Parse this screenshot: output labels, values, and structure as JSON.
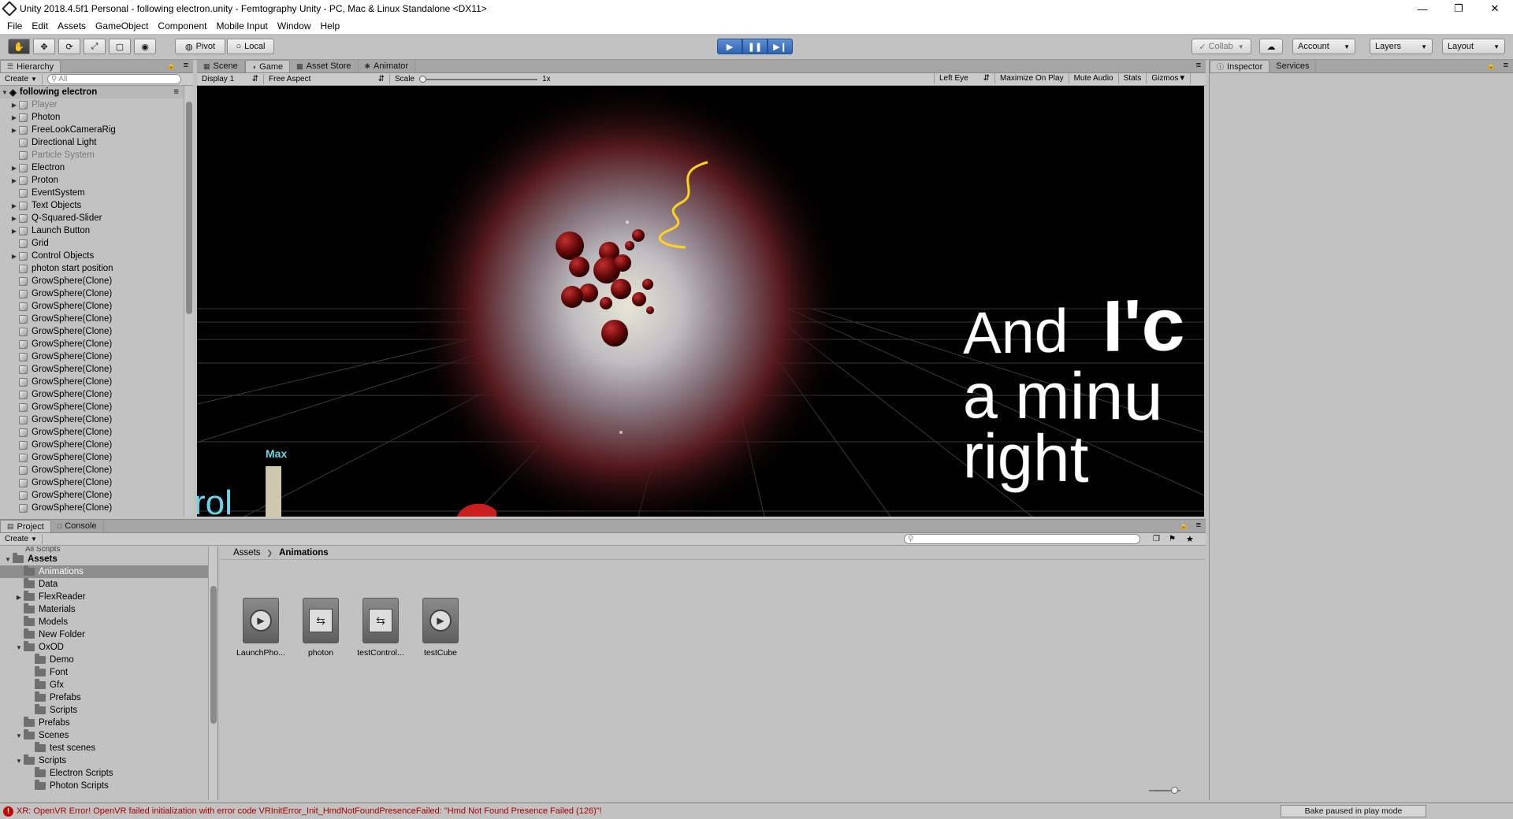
{
  "window": {
    "title": "Unity 2018.4.5f1 Personal - following electron.unity - Femtography Unity - PC, Mac & Linux Standalone <DX11>"
  },
  "menu": [
    "File",
    "Edit",
    "Assets",
    "GameObject",
    "Component",
    "Mobile Input",
    "Window",
    "Help"
  ],
  "toolbar": {
    "pivot": "Pivot",
    "local": "Local",
    "collab": "Collab",
    "account": "Account",
    "layers": "Layers",
    "layout": "Layout"
  },
  "hierarchy": {
    "tab": "Hierarchy",
    "create": "Create",
    "search_placeholder": "All",
    "scene": "following electron",
    "items": [
      {
        "label": "Player",
        "dim": true,
        "arrow": true
      },
      {
        "label": "Photon",
        "dim": false,
        "arrow": true
      },
      {
        "label": "FreeLookCameraRig",
        "dim": false,
        "arrow": true
      },
      {
        "label": "Directional Light",
        "dim": false,
        "arrow": false
      },
      {
        "label": "Particle System",
        "dim": true,
        "arrow": false
      },
      {
        "label": "Electron",
        "dim": false,
        "arrow": true
      },
      {
        "label": "Proton",
        "dim": false,
        "arrow": true
      },
      {
        "label": "EventSystem",
        "dim": false,
        "arrow": false
      },
      {
        "label": "Text Objects",
        "dim": false,
        "arrow": true
      },
      {
        "label": "Q-Squared-Slider",
        "dim": false,
        "arrow": true
      },
      {
        "label": "Launch Button",
        "dim": false,
        "arrow": true
      },
      {
        "label": "Grid",
        "dim": false,
        "arrow": false
      },
      {
        "label": "Control Objects",
        "dim": false,
        "arrow": true
      },
      {
        "label": "photon start position",
        "dim": false,
        "arrow": false
      },
      {
        "label": "GrowSphere(Clone)",
        "dim": false,
        "arrow": false
      },
      {
        "label": "GrowSphere(Clone)",
        "dim": false,
        "arrow": false
      },
      {
        "label": "GrowSphere(Clone)",
        "dim": false,
        "arrow": false
      },
      {
        "label": "GrowSphere(Clone)",
        "dim": false,
        "arrow": false
      },
      {
        "label": "GrowSphere(Clone)",
        "dim": false,
        "arrow": false
      },
      {
        "label": "GrowSphere(Clone)",
        "dim": false,
        "arrow": false
      },
      {
        "label": "GrowSphere(Clone)",
        "dim": false,
        "arrow": false
      },
      {
        "label": "GrowSphere(Clone)",
        "dim": false,
        "arrow": false
      },
      {
        "label": "GrowSphere(Clone)",
        "dim": false,
        "arrow": false
      },
      {
        "label": "GrowSphere(Clone)",
        "dim": false,
        "arrow": false
      },
      {
        "label": "GrowSphere(Clone)",
        "dim": false,
        "arrow": false
      },
      {
        "label": "GrowSphere(Clone)",
        "dim": false,
        "arrow": false
      },
      {
        "label": "GrowSphere(Clone)",
        "dim": false,
        "arrow": false
      },
      {
        "label": "GrowSphere(Clone)",
        "dim": false,
        "arrow": false
      },
      {
        "label": "GrowSphere(Clone)",
        "dim": false,
        "arrow": false
      },
      {
        "label": "GrowSphere(Clone)",
        "dim": false,
        "arrow": false
      },
      {
        "label": "GrowSphere(Clone)",
        "dim": false,
        "arrow": false
      },
      {
        "label": "GrowSphere(Clone)",
        "dim": false,
        "arrow": false
      },
      {
        "label": "GrowSphere(Clone)",
        "dim": false,
        "arrow": false
      }
    ]
  },
  "game": {
    "tabs": [
      "Scene",
      "Game",
      "Asset Store",
      "Animator"
    ],
    "active_tab": "Game",
    "display": "Display 1",
    "aspect": "Free Aspect",
    "scale_label": "Scale",
    "scale_value": "1x",
    "eye": "Left Eye",
    "toggles": [
      "Maximize On Play",
      "Mute Audio",
      "Stats",
      "Gizmos"
    ],
    "overlay_text": {
      "line1a": "And",
      "line1b": "I'c",
      "line2": "a minu",
      "line3": "right",
      "left_text": "rol",
      "slider_label": "Max"
    }
  },
  "inspector": {
    "tabs": [
      "Inspector",
      "Services"
    ]
  },
  "project": {
    "tabs": [
      "Project",
      "Console"
    ],
    "create": "Create",
    "cut_top_item": "All Scripts",
    "tree": [
      {
        "label": "Assets",
        "level": 0,
        "arrow": "open",
        "bold": true
      },
      {
        "label": "Animations",
        "level": 1,
        "arrow": "",
        "selected": true
      },
      {
        "label": "Data",
        "level": 1,
        "arrow": ""
      },
      {
        "label": "FlexReader",
        "level": 1,
        "arrow": "closed"
      },
      {
        "label": "Materials",
        "level": 1,
        "arrow": ""
      },
      {
        "label": "Models",
        "level": 1,
        "arrow": ""
      },
      {
        "label": "New Folder",
        "level": 1,
        "arrow": ""
      },
      {
        "label": "OxOD",
        "level": 1,
        "arrow": "open"
      },
      {
        "label": "Demo",
        "level": 2,
        "arrow": ""
      },
      {
        "label": "Font",
        "level": 2,
        "arrow": ""
      },
      {
        "label": "Gfx",
        "level": 2,
        "arrow": ""
      },
      {
        "label": "Prefabs",
        "level": 2,
        "arrow": ""
      },
      {
        "label": "Scripts",
        "level": 2,
        "arrow": ""
      },
      {
        "label": "Prefabs",
        "level": 1,
        "arrow": ""
      },
      {
        "label": "Scenes",
        "level": 1,
        "arrow": "open"
      },
      {
        "label": "test scenes",
        "level": 2,
        "arrow": ""
      },
      {
        "label": "Scripts",
        "level": 1,
        "arrow": "open"
      },
      {
        "label": "Electron Scripts",
        "level": 2,
        "arrow": ""
      },
      {
        "label": "Photon Scripts",
        "level": 2,
        "arrow": ""
      }
    ],
    "breadcrumb": {
      "root": "Assets",
      "current": "Animations"
    },
    "assets": [
      {
        "name": "LaunchPho...",
        "kind": "clip"
      },
      {
        "name": "photon",
        "kind": "controller"
      },
      {
        "name": "testControl...",
        "kind": "controller"
      },
      {
        "name": "testCube",
        "kind": "clip"
      }
    ]
  },
  "status": {
    "error": "XR: OpenVR Error! OpenVR failed initialization with error code VRInitError_Init_HmdNotFoundPresenceFailed: \"Hmd Not Found Presence Failed (126)\"!",
    "bake": "Bake paused in play mode"
  }
}
